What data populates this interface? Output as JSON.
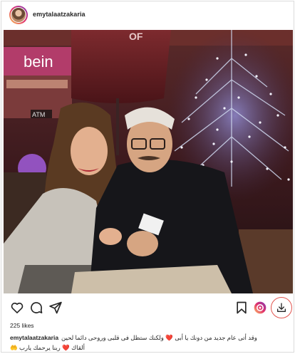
{
  "post": {
    "username": "emytalaatzakaria",
    "likes_text": "225 likes",
    "caption": {
      "username": "emytalaatzakaria",
      "line1_text": "وقد أتى عام جديد من دونك يا أبى",
      "line1_heart": "❤️",
      "line1_text_b": "ولكنك ستظل فى قلبى وروحى دائما لحين",
      "line2_text": "ألقاك",
      "line2_heart": "❤️",
      "line2_text_b": "ربنا يرحمك يارب",
      "line2_emoji": "🤲"
    },
    "photo": {
      "signs": [
        "bein",
        "ATM",
        "OF"
      ]
    }
  },
  "icons": {
    "avatar": "profile-avatar",
    "like": "heart-icon",
    "comment": "comment-icon",
    "share": "send-icon",
    "save": "bookmark-icon",
    "reels": "reels-download-icon",
    "download": "download-icon"
  },
  "colors": {
    "text": "#262626",
    "border": "#dbdbdb",
    "download_ring": "#e2554f",
    "heart": "#e0245e"
  }
}
